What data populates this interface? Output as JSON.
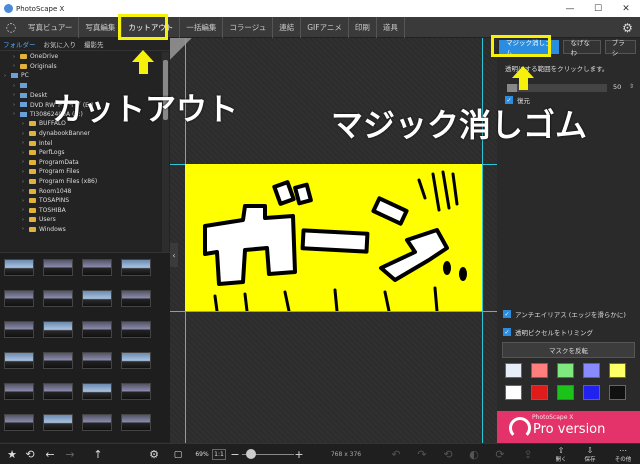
{
  "window": {
    "title": "PhotoScape X",
    "minimize": "—",
    "maximize": "☐",
    "close": "✕"
  },
  "menu": {
    "tabs": [
      "写真ビュアー",
      "写真編集",
      "カットアウト",
      "一括編集",
      "コラージュ",
      "連結",
      "GIFアニメ",
      "印刷",
      "道具"
    ],
    "active": "カットアウト"
  },
  "left": {
    "navtabs": [
      "フォルダー",
      "お気に入り",
      "撮影先"
    ],
    "tree": [
      {
        "label": "OneDrive",
        "type": "folder",
        "indent": 1
      },
      {
        "label": "Originals",
        "type": "folder",
        "indent": 1
      },
      {
        "label": "PC",
        "type": "drive",
        "indent": 0
      },
      {
        "label": "",
        "type": "drive",
        "indent": 1
      },
      {
        "label": "Deskt",
        "type": "drive",
        "indent": 1
      },
      {
        "label": "DVD RW ドライブ (E:)",
        "type": "drive",
        "indent": 1
      },
      {
        "label": "TI30862400A (C:)",
        "type": "drive",
        "indent": 1
      },
      {
        "label": "BUFFALO",
        "type": "folder",
        "indent": 2
      },
      {
        "label": "dynabookBanner",
        "type": "folder",
        "indent": 2
      },
      {
        "label": "Intel",
        "type": "folder",
        "indent": 2
      },
      {
        "label": "PerfLogs",
        "type": "folder",
        "indent": 2
      },
      {
        "label": "ProgramData",
        "type": "folder",
        "indent": 2
      },
      {
        "label": "Program Files",
        "type": "folder",
        "indent": 2
      },
      {
        "label": "Program Files (x86)",
        "type": "folder",
        "indent": 2
      },
      {
        "label": "Room1048",
        "type": "folder",
        "indent": 2
      },
      {
        "label": "TOSAPINS",
        "type": "folder",
        "indent": 2
      },
      {
        "label": "TOSHIBA",
        "type": "folder",
        "indent": 2
      },
      {
        "label": "Users",
        "type": "folder",
        "indent": 2
      },
      {
        "label": "Windows",
        "type": "folder",
        "indent": 2
      }
    ]
  },
  "bottom": {
    "zoom": "69%",
    "ratio": "1:1",
    "size": "768 x 376",
    "open": "開く",
    "save": "保存",
    "more": "その他"
  },
  "canvas": {
    "badge": "PRO",
    "text": "ガーン"
  },
  "right": {
    "tabs": [
      "マジック消しゴム",
      "なげなわ",
      "ブラシ"
    ],
    "hint": "透明にする範囲をクリックします。",
    "tolerance_value": "50",
    "tolerance_level": 0.1,
    "restore": "復元",
    "antialias": "アンチエイリアス (エッジを滑らかに)",
    "trim": "透明ピクセルをトリミング",
    "invert": "マスクを反転",
    "swatches": [
      "#e8eef7",
      "#ff7f7f",
      "#7fe87f",
      "#8a8aff",
      "#ffff66",
      "#ffffff",
      "#e01b1b",
      "#1ac21a",
      "#2222ee",
      "#111111"
    ],
    "promo_small": "PhotoScape X",
    "promo_big": "Pro version"
  },
  "annotations": {
    "left": "カットアウト",
    "right": "マジック消しゴム"
  }
}
